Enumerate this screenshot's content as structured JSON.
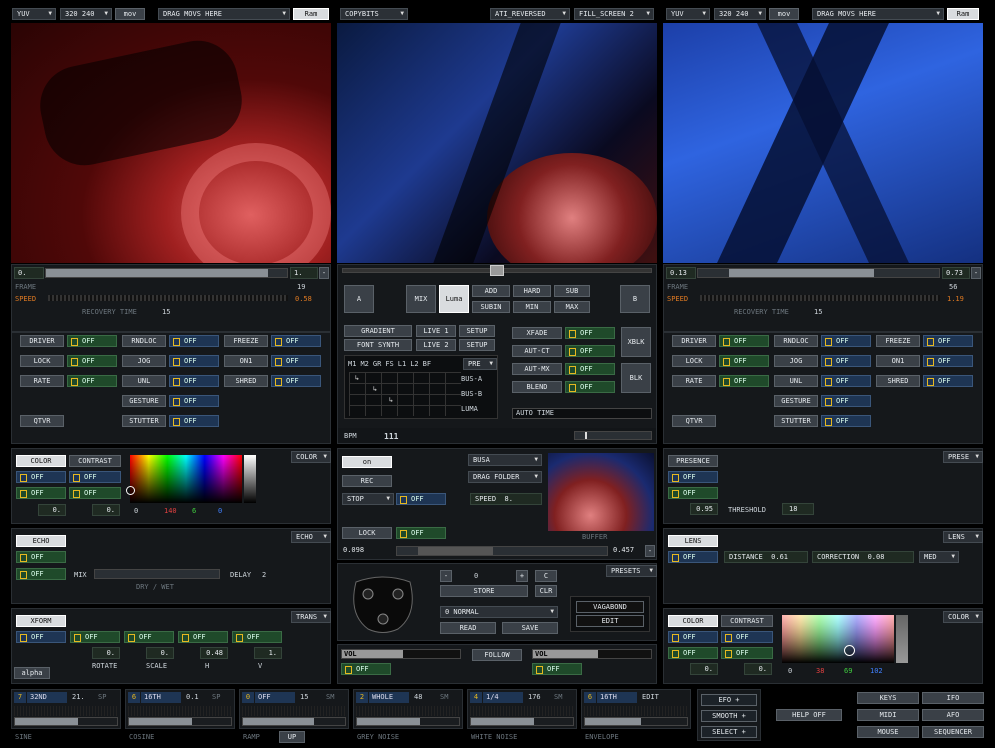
{
  "top": {
    "left": {
      "fmt": "YUV",
      "res": "320 240",
      "mov": "mov",
      "drag": "DRAG MOVS HERE",
      "ram": "Ram"
    },
    "center": {
      "mode": "COPYBITS",
      "renderer": "ATI_REVERSED",
      "fill": "FILL_SCREEN 2"
    },
    "right": {
      "fmt": "YUV",
      "res": "320 240",
      "mov": "mov",
      "drag": "DRAG MOVS HERE",
      "ram": "Ram"
    }
  },
  "deckA": {
    "pos_start": "0.",
    "pos_end": "1.",
    "minus": "-",
    "frame_label": "FRAME",
    "frame_val": "19",
    "speed_label": "SPEED",
    "speed_val": "0.58",
    "recovery_label": "RECOVERY TIME",
    "recovery_val": "15",
    "progress": 0.92
  },
  "deckB": {
    "pos_start": "0.13",
    "pos_end": "0.73",
    "minus": "-",
    "frame_label": "FRAME",
    "frame_val": "56",
    "speed_label": "SPEED",
    "speed_val": "1.19",
    "recovery_label": "RECOVERY TIME",
    "recovery_val": "15",
    "progress_start": 0.13,
    "progress_end": 0.73
  },
  "controls": {
    "driver": "DRIVER",
    "lock": "LOCK",
    "rate": "RATE",
    "rndloc": "RNDLOC",
    "jog": "JOG",
    "unl": "UNL",
    "gesture": "GESTURE",
    "stutter": "STUTTER",
    "freeze": "FREEZE",
    "on1": "ON1",
    "shred": "SHRED",
    "qtvr": "QTVR",
    "off": "OFF",
    "zero": "0"
  },
  "mixer": {
    "a": "A",
    "b": "B",
    "mix": "MIX",
    "luma": "Luma",
    "add": "ADD",
    "hard": "HARD",
    "sub": "SUB",
    "subin": "SUBIN",
    "min": "MIN",
    "max": "MAX",
    "gradient": "GRADIENT",
    "live1": "LIVE 1",
    "setup": "SETUP",
    "fontsynth": "FONT SYNTH",
    "live2": "LIVE 2",
    "xfade": "XFADE",
    "autct": "AUT-CT",
    "autmx": "AUT-MX",
    "blend": "BLEND",
    "xblk": "XBLK",
    "blk": "BLK",
    "matrix_headers": [
      "M1",
      "M2",
      "GR",
      "FS",
      "L1",
      "L2",
      "BF"
    ],
    "pre": "PRE",
    "busa": "BUS-A",
    "busb": "BUS-B",
    "bus_luma": "LUMA",
    "autotime": "AUTO TIME",
    "bpm_label": "BPM",
    "bpm_val": "111"
  },
  "colorL": {
    "color": "COLOR",
    "contrast": "CONTRAST",
    "menu": "COLOR",
    "v1": "0.",
    "v2": "0.",
    "r": "0",
    "g": "140",
    "b": "6",
    "a": "0"
  },
  "echo": {
    "echo": "ECHO",
    "menu": "ECHO",
    "mix": "MIX",
    "drywet": "DRY / WET",
    "delay": "DELAY",
    "delay_val": "2"
  },
  "xform": {
    "xform": "XFORM",
    "menu": "TRANS",
    "alpha": "alpha",
    "rotate": "ROTATE",
    "scale": "SCALE",
    "h": "H",
    "v": "V",
    "rot_val": "0.",
    "scale_val": "0.",
    "h_val": "0.48",
    "v_val": "1."
  },
  "sampler": {
    "on": "on",
    "rec": "REC",
    "stop": "STOP",
    "lock": "LOCK",
    "busa": "BUSA",
    "dragfolder": "DRAG FOLDER",
    "speed": "SPEED",
    "speed_val": "8.",
    "buffer": "BUFFER",
    "pos_start": "0.098",
    "pos_end": "0.457",
    "minus": "-",
    "progress_start": 0.098,
    "progress_end": 0.457
  },
  "presets": {
    "menu": "PRESETS",
    "minus": "-",
    "plus": "+",
    "val": "0",
    "c": "C",
    "store": "STORE",
    "clr": "CLR",
    "normal": "0 NORMAL",
    "read": "READ",
    "save": "SAVE",
    "vagabond": "VAGABOND",
    "edit": "EDIT"
  },
  "volume": {
    "vol": "VOL",
    "follow": "FOLLOW"
  },
  "presence": {
    "presence": "PRESENCE",
    "menu": "PRESE",
    "v": "0.95",
    "threshold": "THRESHOLD",
    "threshold_val": "18"
  },
  "lens": {
    "lens": "LENS",
    "menu": "LENS",
    "distance": "DISTANCE",
    "distance_val": "0.61",
    "correction": "CORRECTION",
    "correction_val": "0.08",
    "med": "MED"
  },
  "colorR": {
    "color": "COLOR",
    "contrast": "CONTRAST",
    "menu": "COLOR",
    "v1": "0.",
    "v2": "0.",
    "r": "0",
    "g": "38",
    "b": "69",
    "a": "102"
  },
  "lfos": [
    {
      "num": "7",
      "div": "32ND",
      "val": "21.",
      "sp": "SP",
      "name": "SINE"
    },
    {
      "num": "6",
      "div": "16TH",
      "val": "0.1",
      "sp": "SP",
      "name": "COSINE"
    },
    {
      "num": "0",
      "div": "OFF",
      "val": "15",
      "sp": "SM",
      "name": "RAMP",
      "extra": "UP"
    },
    {
      "num": "2",
      "div": "WHOLE",
      "val": "48",
      "sp": "SM",
      "name": "GREY NOISE"
    },
    {
      "num": "4",
      "div": "1/4",
      "val": "176",
      "sp": "SM",
      "name": "WHITE NOISE"
    },
    {
      "num": "6",
      "div": "16TH",
      "val": "EDIT",
      "sp": "",
      "name": "ENVELOPE"
    }
  ],
  "bottom": {
    "efo": "EFO +",
    "smooth": "SMOOTH +",
    "select": "SELECT +",
    "helpoff": "HELP OFF",
    "keys": "KEYS",
    "ifo": "IFO",
    "midi": "MIDI",
    "afo": "AFO",
    "mouse": "MOUSE",
    "sequencer": "SEQUENCER"
  },
  "colors": {
    "panel": "#15181b",
    "green_toggle": "#1f4a2a",
    "blue_toggle": "#1e3554",
    "orange": "#e07a22",
    "indicator": "#e6b820"
  }
}
